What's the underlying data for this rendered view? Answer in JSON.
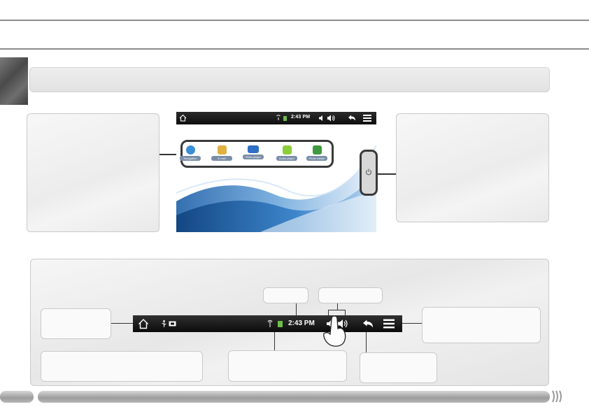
{
  "page": {
    "title": "",
    "section_banner": ""
  },
  "tablet_screen": {
    "clock": "2:43 PM",
    "apps": [
      {
        "label": "Navigation",
        "color": "#3a8fd6"
      },
      {
        "label": "E-mail",
        "color": "#e0b040"
      },
      {
        "label": "Video player",
        "color": "#2f6fc4"
      },
      {
        "label": "Audio player",
        "color": "#8ccd3a"
      },
      {
        "label": "Photo viewer",
        "color": "#3f9a3f"
      }
    ]
  },
  "status_bar": {
    "clock": "2:43 PM",
    "icons": [
      "home-icon",
      "usb-icon",
      "card-icon",
      "wifi-icon",
      "battery-icon",
      "volume-down-icon",
      "volume-up-icon",
      "back-icon",
      "menu-icon"
    ]
  },
  "colors": {
    "bar_dark": "#111111",
    "battery_green": "#6cc04a",
    "footer_grey": "#b4b4b4"
  }
}
